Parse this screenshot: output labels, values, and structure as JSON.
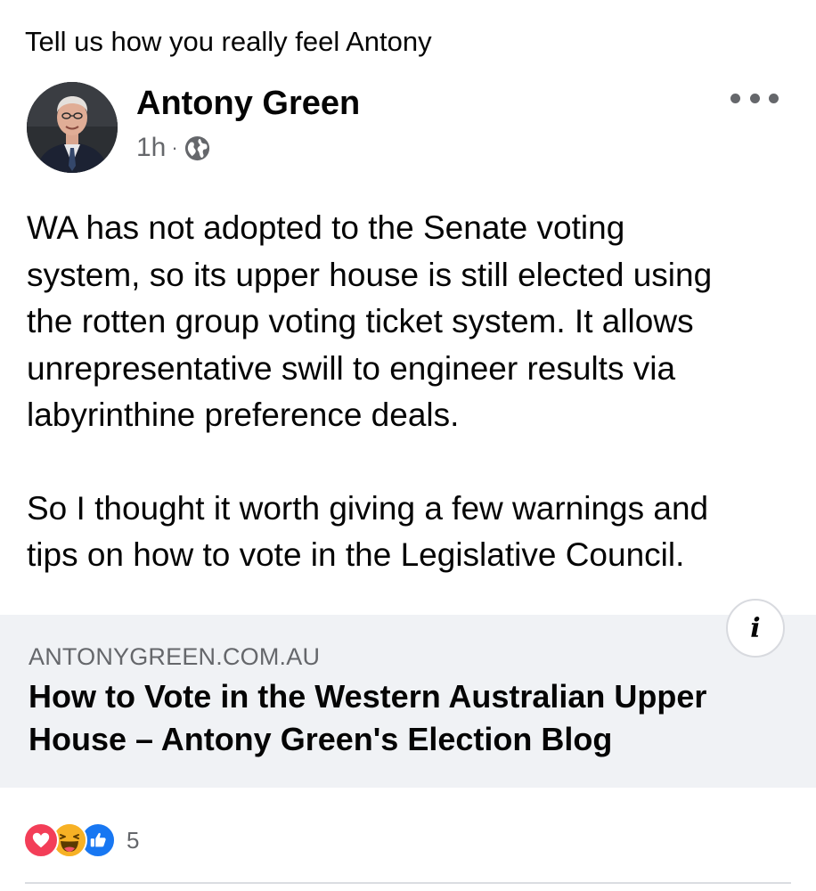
{
  "share_caption": "Tell us how you really feel Antony",
  "post": {
    "author": "Antony Green",
    "time": "1h",
    "separator": "·",
    "audience_icon": "globe-icon",
    "more_icon": "more-options-icon",
    "paragraphs": [
      "WA has not adopted to the Senate voting\nsystem, so its upper house is still elected using\nthe rotten group voting ticket system. It allows\nunrepresentative swill to engineer results via\nlabyrinthine preference deals.",
      "So I thought it worth giving a few warnings and\ntips on how to vote in the Legislative Council."
    ]
  },
  "link_preview": {
    "domain": "ANTONYGREEN.COM.AU",
    "title": "How to Vote in the Western Australian Upper House – Antony Green's Election Blog",
    "info_label": "i"
  },
  "reactions": {
    "icons": [
      "love-reaction-icon",
      "haha-reaction-icon",
      "like-reaction-icon"
    ],
    "count": "5"
  },
  "colors": {
    "background": "#ffffff",
    "text": "#050505",
    "secondary_text": "#65676b",
    "card_background": "#f0f2f5",
    "love": "#f33e58",
    "haha": "#f7b125",
    "like": "#1877f2"
  }
}
